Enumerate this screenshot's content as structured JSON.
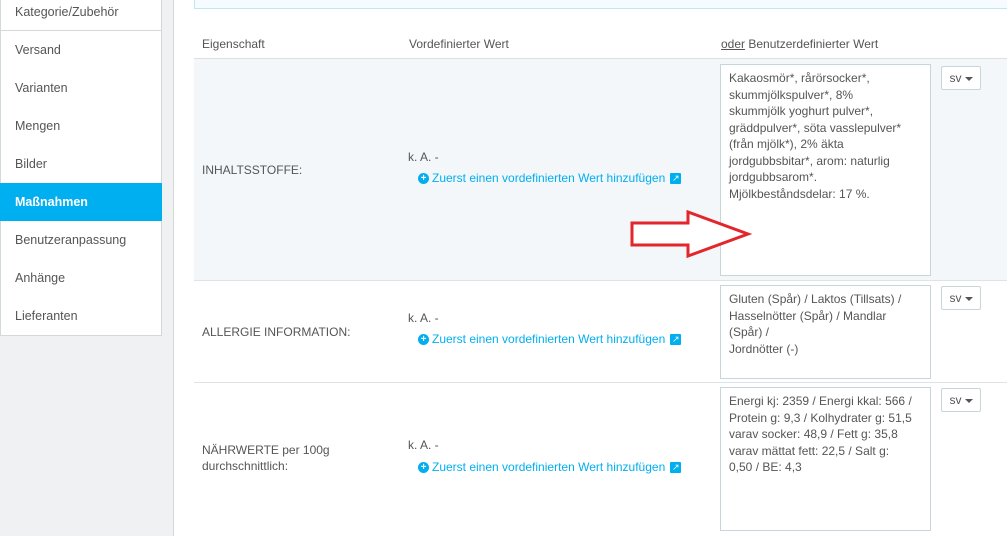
{
  "sidebar": {
    "items": [
      {
        "label": "Kategorie/Zubehör",
        "active": false
      },
      {
        "label": "Versand",
        "active": false
      },
      {
        "label": "Varianten",
        "active": false
      },
      {
        "label": "Mengen",
        "active": false
      },
      {
        "label": "Bilder",
        "active": false
      },
      {
        "label": "Maßnahmen",
        "active": true
      },
      {
        "label": "Benutzeranpassung",
        "active": false
      },
      {
        "label": "Anhänge",
        "active": false
      },
      {
        "label": "Lieferanten",
        "active": false
      }
    ]
  },
  "table": {
    "headers": {
      "property": "Eigenschaft",
      "predefined": "Vordefinierter Wert",
      "custom_prefix": "oder",
      "custom": " Benutzerdefinierter Wert"
    },
    "rows": [
      {
        "label": "INHALTSSTOFFE:",
        "predefined": "k. A. -",
        "add_link": "Zuerst einen vordefinierten Wert hinzufügen",
        "custom_value": "Kakaosmör*, rårörsocker*,\nskummjölkspulver*, 8%\nskummjölk yoghurt pulver*,\ngräddpulver*, söta vasslepulver*\n(från mjölk*), 2% äkta\njordgubbsbitar*, arom: naturlig\njordgubbsarom*.\nMjölkbeståndsdelar: 17 %.",
        "lang": "sv"
      },
      {
        "label": "ALLERGIE INFORMATION:",
        "predefined": "k. A. -",
        "add_link": "Zuerst einen vordefinierten Wert hinzufügen",
        "custom_value": "Gluten (Spår) / Laktos (Tillsats) /\nHasselnötter (Spår) / Mandlar\n(Spår) /\nJordnötter (-)",
        "lang": "sv"
      },
      {
        "label": "NÄHRWERTE per 100g\ndurchschnittlich:",
        "predefined": "k. A. -",
        "add_link": "Zuerst einen vordefinierten Wert hinzufügen",
        "custom_value": "Energi kj: 2359 / Energi kkal: 566 /\nProtein g: 9,3 / Kolhydrater g: 51,5\nvarav socker: 48,9 / Fett g: 35,8\nvarav mättat fett: 22,5 / Salt g:\n0,50 / BE: 4,3",
        "lang": "sv"
      }
    ]
  },
  "colors": {
    "accent": "#00aff0",
    "arrow": "#e3262b"
  },
  "icons": [
    "plus-circle-icon",
    "external-link-icon",
    "caret-down-icon",
    "red-arrow-annotation"
  ]
}
